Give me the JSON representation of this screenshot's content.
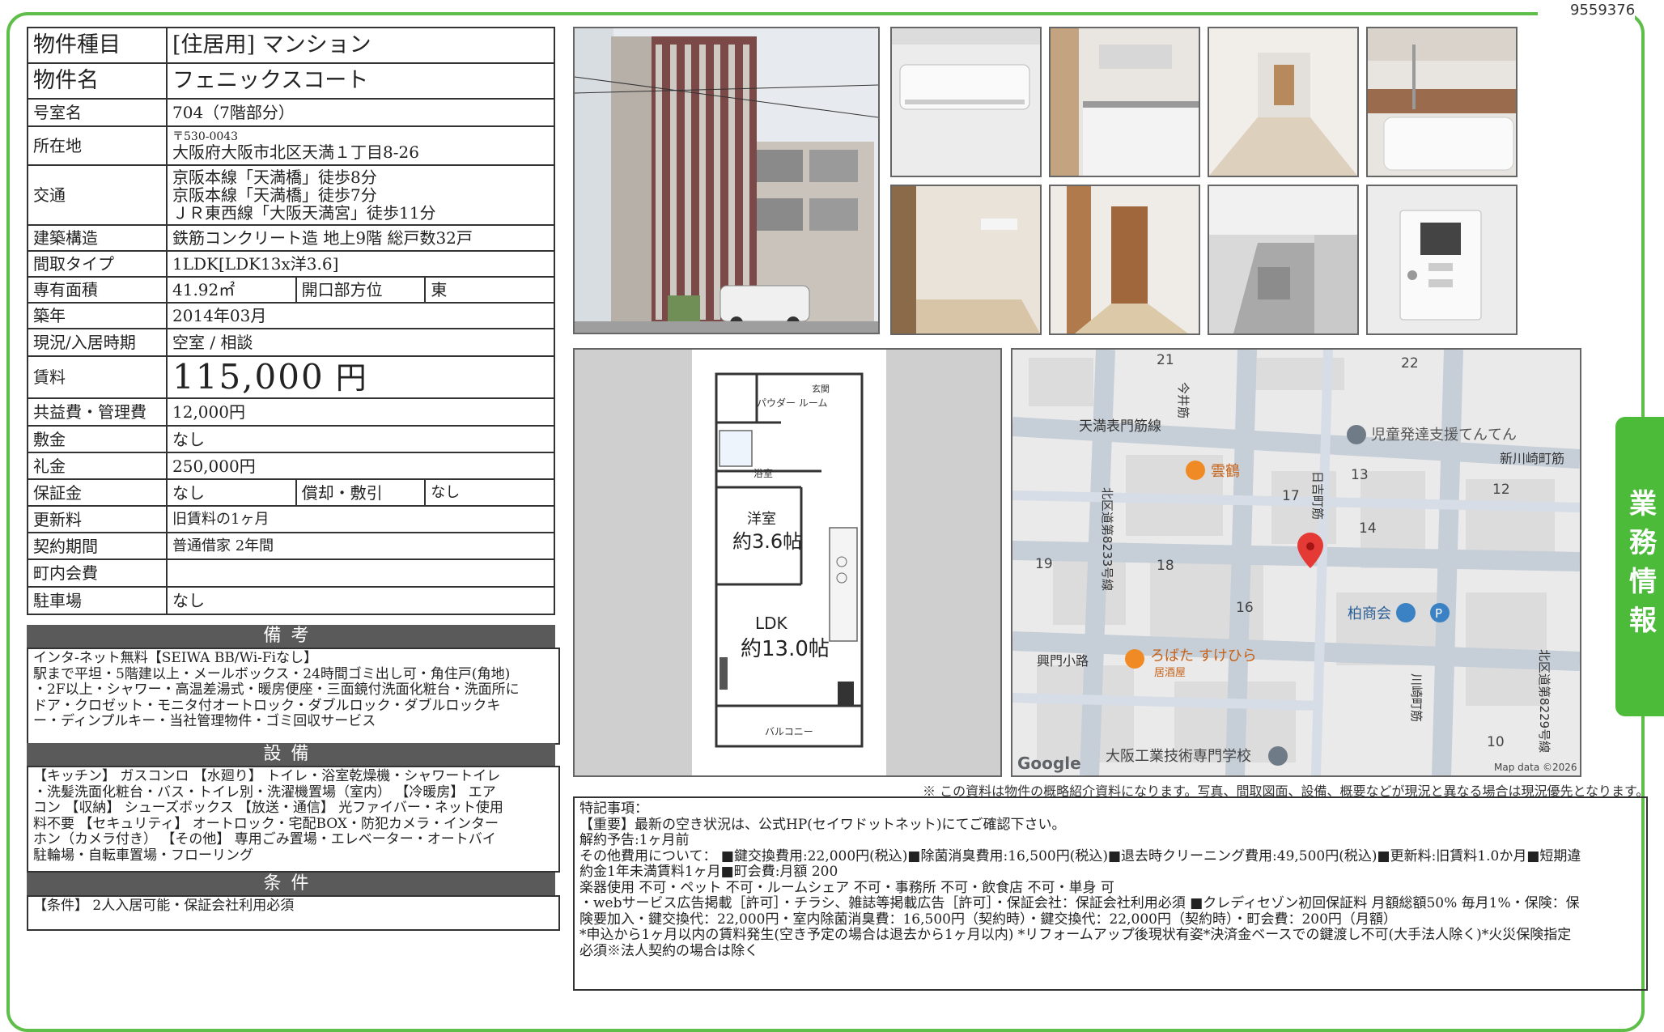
{
  "doc_number": "9559376",
  "side_tab": "業務情報",
  "spec": {
    "type_label": "物件種目",
    "type_value": "[住居用] マンション",
    "name_label": "物件名",
    "name_value": "フェニックスコート",
    "room_label": "号室名",
    "room_value": "704（7階部分）",
    "address_label": "所在地",
    "address_postal": "〒530-0043",
    "address_value": "大阪府大阪市北区天満１丁目8-26",
    "transport_label": "交通",
    "transport_1": "京阪本線「天満橋」徒歩8分",
    "transport_2": "京阪本線「天満橋」徒歩7分",
    "transport_3": "ＪＲ東西線「大阪天満宮」徒歩11分",
    "structure_label": "建築構造",
    "structure_value": "鉄筋コンクリート造 地上9階 総戸数32戸",
    "layout_label": "間取タイプ",
    "layout_value": "1LDK[LDK13x洋3.6]",
    "area_label": "専有面積",
    "area_value": "41.92㎡",
    "direction_label": "開口部方位",
    "direction_value": "東",
    "built_label": "築年",
    "built_value": "2014年03月",
    "status_label": "現況/入居時期",
    "status_value": "空室 / 相談",
    "rent_label": "賃料",
    "rent_value": "115,000",
    "rent_unit": "円",
    "fee_label": "共益費・管理費",
    "fee_value": "12,000円",
    "deposit_label": "敷金",
    "deposit_value": "なし",
    "key_money_label": "礼金",
    "key_money_value": "250,000円",
    "guarantee_label": "保証金",
    "guarantee_value": "なし",
    "amort_label": "償却・敷引",
    "amort_value": "なし",
    "renewal_label": "更新料",
    "renewal_value": "旧賃料の1ヶ月",
    "contract_label": "契約期間",
    "contract_value": "普通借家 2年間",
    "community_label": "町内会費",
    "community_value": "",
    "parking_label": "駐車場",
    "parking_value": "なし"
  },
  "remarks": {
    "title": "備考",
    "lines": [
      "インタ-ネット無料【SEIWA BB/Wi-Fiなし】",
      "駅まで平坦・5階建以上・メールボックス・24時間ゴミ出し可・角住戸(角地)",
      "・2F以上・シャワー・高温差湯式・暖房便座・三面鏡付洗面化粧台・洗面所に",
      "ドア・クロゼット・モニタ付オートロック・ダブルロック・ダブルロックキ",
      "ー・ディンプルキー・当社管理物件・ゴミ回収サービス"
    ]
  },
  "equipment": {
    "title": "設備",
    "lines": [
      "【キッチン】 ガスコンロ 【水廻り】 トイレ・浴室乾燥機・シャワートイレ",
      "・洗髪洗面化粧台・バス・トイレ別・洗濯機置場（室内） 【冷暖房】 エア",
      "コン 【収納】 シューズボックス 【放送・通信】 光ファイバー・ネット使用",
      "料不要 【セキュリティ】 オートロック・宅配BOX・防犯カメラ・インター",
      "ホン（カメラ付き） 【その他】 専用ごみ置場・エレベーター・オートバイ",
      "駐輪場・自転車置場・フローリング"
    ]
  },
  "conditions": {
    "title": "条件",
    "lines": [
      "【条件】 2人入居可能・保証会社利用必須"
    ]
  },
  "floorplan": {
    "powder": "パウダー\nルーム",
    "bath": "浴室",
    "entrance": "玄関",
    "western": "洋室",
    "western_size": "約3.6帖",
    "ldk": "LDK",
    "ldk_size": "約13.0帖",
    "balcony": "バルコニー"
  },
  "map": {
    "labels": {
      "b21": "21",
      "b22": "22",
      "b13": "13",
      "b12": "12",
      "b17": "17",
      "b14": "14",
      "b19": "19",
      "b18": "18",
      "b16": "16",
      "b10": "10",
      "street_tenma": "天満表門筋線",
      "street_shinkawa": "新川崎町筋",
      "street_imai": "今井筋",
      "street_hiyoshi": "日吉町筋",
      "street_kitaku": "北区道第8233号線",
      "street_kitaku2": "北区道第8229号線",
      "street_kawasaki": "川崎町筋",
      "street_kohmon": "興門小路",
      "poi_center": "児童発達支援てんてん",
      "poi_kumotsuru": "雲鶴",
      "poi_kashiwa": "柏商会",
      "poi_robata": "ろばた すけひら",
      "poi_robata_sub": "居酒屋",
      "poi_school": "大阪工業技術専門学校",
      "google": "Google",
      "mapdata": "Map data ©2026"
    }
  },
  "disclaimer": "※ この資料は物件の概略紹介資料になります。写真、間取図面、設備、概要などが現況と異なる場合は現況優先となります。",
  "notes": {
    "lines": [
      "特記事項：",
      "【重要】最新の空き状況は、公式HP(セイワドットネット)にてご確認下さい。",
      "解約予告:1ヶ月前",
      "その他費用について： ■鍵交換費用:22,000円(税込)■除菌消臭費用:16,500円(税込)■退去時クリーニング費用:49,500円(税込)■更新料:旧賃料1.0か月■短期違",
      "約金1年未満賃料1ヶ月■町会費:月額 200",
      "楽器使用 不可・ペット 不可・ルームシェア 不可・事務所 不可・飲食店 不可・単身 可",
      "・webサービス広告掲載［許可］・チラシ、雑誌等掲載広告［許可］・保証会社：保証会社利用必須 ■クレディセゾン初回保証料 月額総額50% 毎月1%・保険：保",
      "険要加入・鍵交換代：22,000円・室内除菌消臭費：16,500円（契約時）・鍵交換代：22,000円（契約時）・町会費：200円（月額）",
      "*申込から1ヶ月以内の賃料発生(空き予定の場合は退去から1ヶ月以内) *リフォームアップ後現状有姿*決済金ベースでの鍵渡し不可(大手法人除く)*火災保険指定",
      "必須※法人契約の場合は除く"
    ]
  },
  "colors": {
    "frame": "#5fbe4a",
    "section_header": "#5a5a5a",
    "map_pin": "#e53935"
  }
}
